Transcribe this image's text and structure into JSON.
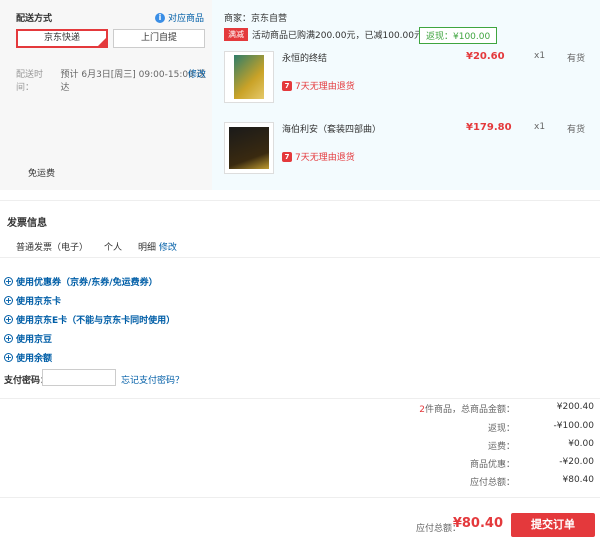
{
  "shipping": {
    "title": "配送方式",
    "pair_link": "对应商品",
    "options": [
      "京东快递",
      "上门自提"
    ],
    "time_label": "配送时间：",
    "time_value": "预计 6月3日[周三] 09:00-15:00 送达",
    "edit": "修改",
    "free_coupon": "免运费"
  },
  "order": {
    "seller": "商家：京东自营",
    "promo_tag": "满减",
    "promo_text": "活动商品已购满200.00元，已减100.00元现金",
    "back_label": "返现：¥100.00",
    "items": [
      {
        "name": "永恒的终结",
        "price": "¥20.60",
        "qty": "x1",
        "stock": "有货",
        "return": "7天无理由退货"
      },
      {
        "name": "海伯利安（套装四部曲）",
        "price": "¥179.80",
        "qty": "x1",
        "stock": "有货",
        "return": "7天无理由退货"
      }
    ]
  },
  "invoice": {
    "title": "发票信息",
    "type": "普通发票（电子）",
    "holder": "个人",
    "detail": "明细",
    "edit": "修改"
  },
  "options": [
    "使用优惠券（京券/东券/免运费券）",
    "使用京东卡",
    "使用京东E卡（不能与京东卡同时使用）",
    "使用京豆",
    "使用余额"
  ],
  "payment": {
    "label": "支付密码：",
    "forgot": "忘记支付密码？"
  },
  "summary": {
    "count": "2",
    "rows": [
      {
        "label": "件商品，总商品金额：",
        "value": "¥200.40"
      },
      {
        "label": "返现：",
        "value": "-¥100.00"
      },
      {
        "label": "运费：",
        "value": "¥0.00"
      },
      {
        "label": "商品优惠：",
        "value": "-¥20.00"
      },
      {
        "label": "应付总额：",
        "value": "¥80.40"
      }
    ]
  },
  "total": {
    "label": "应付总额：",
    "value": "¥80.40",
    "submit": "提交订单"
  },
  "colors": {
    "accent": "#e4393c",
    "link": "#005ea7",
    "green": "#3fa53f"
  }
}
